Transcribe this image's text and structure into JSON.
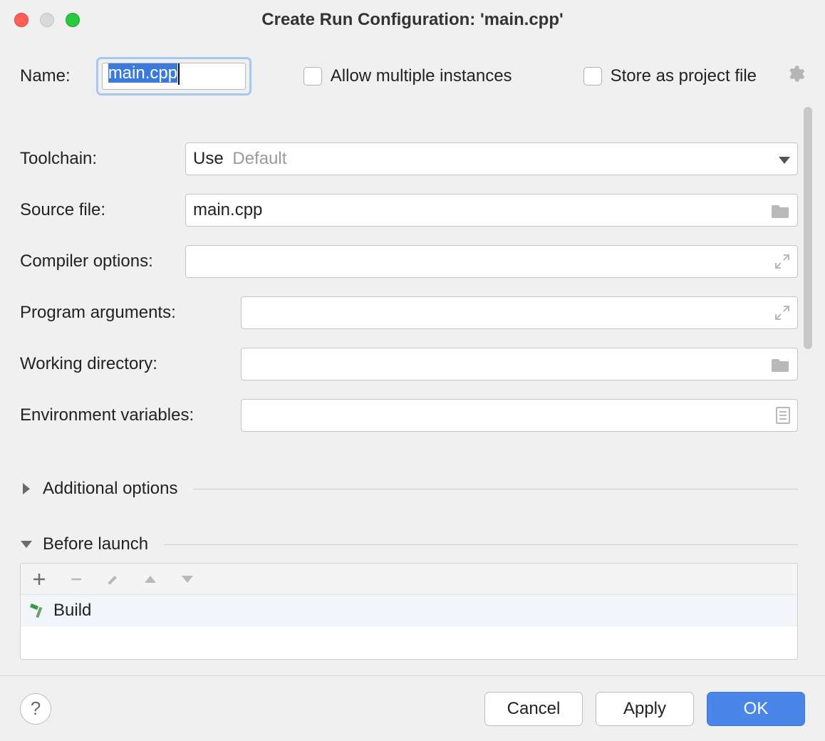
{
  "title": "Create Run Configuration: 'main.cpp'",
  "name_row": {
    "label": "Name:",
    "value": "main.cpp",
    "allow_multiple_label": "Allow multiple instances",
    "allow_multiple_checked": false,
    "store_project_label": "Store as project file",
    "store_project_checked": false
  },
  "fields": {
    "toolchain": {
      "label": "Toolchain:",
      "prefix": "Use",
      "value": "Default"
    },
    "source_file": {
      "label": "Source file:",
      "value": "main.cpp"
    },
    "compiler_options": {
      "label": "Compiler options:",
      "value": ""
    },
    "program_arguments": {
      "label": "Program arguments:",
      "value": ""
    },
    "working_directory": {
      "label": "Working directory:",
      "value": ""
    },
    "environment_variables": {
      "label": "Environment variables:",
      "value": ""
    }
  },
  "sections": {
    "additional_options": {
      "label": "Additional options",
      "expanded": false
    },
    "before_launch": {
      "label": "Before launch",
      "expanded": true
    }
  },
  "before_launch_items": [
    {
      "label": "Build"
    }
  ],
  "buttons": {
    "help": "?",
    "cancel": "Cancel",
    "apply": "Apply",
    "ok": "OK"
  }
}
